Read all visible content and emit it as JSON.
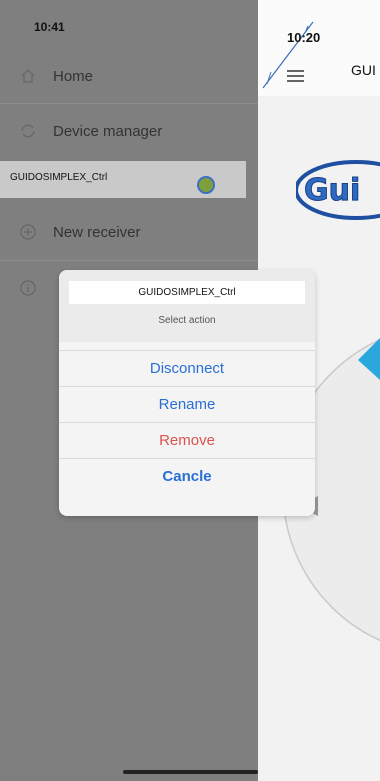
{
  "app": {
    "time": "10:20",
    "title": "GUI",
    "logo_text": "Gui"
  },
  "drawer": {
    "time": "10:41",
    "items": [
      {
        "label": "Home",
        "icon": "home-icon"
      },
      {
        "label": "Device manager",
        "icon": "refresh-icon"
      },
      {
        "label": "New receiver",
        "icon": "plus-circle-icon"
      },
      {
        "label": "",
        "icon": "info-icon"
      }
    ],
    "selected_device": "GUIDOSIMPLEX_Ctrl"
  },
  "sheet": {
    "device_name": "GUIDOSIMPLEX_Ctrl",
    "subtitle": "Select action",
    "actions": [
      {
        "label": "Disconnect"
      },
      {
        "label": "Rename"
      },
      {
        "label": "Remove"
      },
      {
        "label": "Cancle"
      }
    ]
  },
  "colors": {
    "drawer_bg": "#7f7f7f",
    "action_blue": "#2a6fd4",
    "action_red": "#d9534f",
    "dial_accent": "#2aa8de"
  }
}
